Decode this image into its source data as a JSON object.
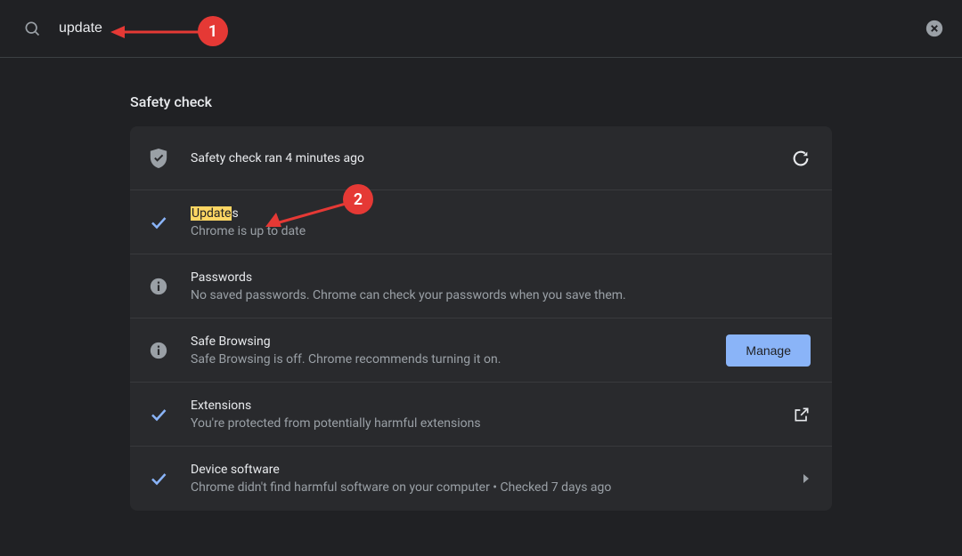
{
  "search": {
    "value": "update"
  },
  "section": {
    "title": "Safety check"
  },
  "rows": {
    "overview": {
      "title": "Safety check ran 4 minutes ago"
    },
    "updates": {
      "title_hl": "Update",
      "title_rest": "s",
      "sub": "Chrome is up to date"
    },
    "passwords": {
      "title": "Passwords",
      "sub": "No saved passwords. Chrome can check your passwords when you save them."
    },
    "safebrowsing": {
      "title": "Safe Browsing",
      "sub": "Safe Browsing is off. Chrome recommends turning it on.",
      "button": "Manage"
    },
    "extensions": {
      "title": "Extensions",
      "sub": "You're protected from potentially harmful extensions"
    },
    "device": {
      "title": "Device software",
      "sub": "Chrome didn't find harmful software on your computer • Checked 7 days ago"
    }
  },
  "annotations": {
    "a1": "1",
    "a2": "2"
  }
}
